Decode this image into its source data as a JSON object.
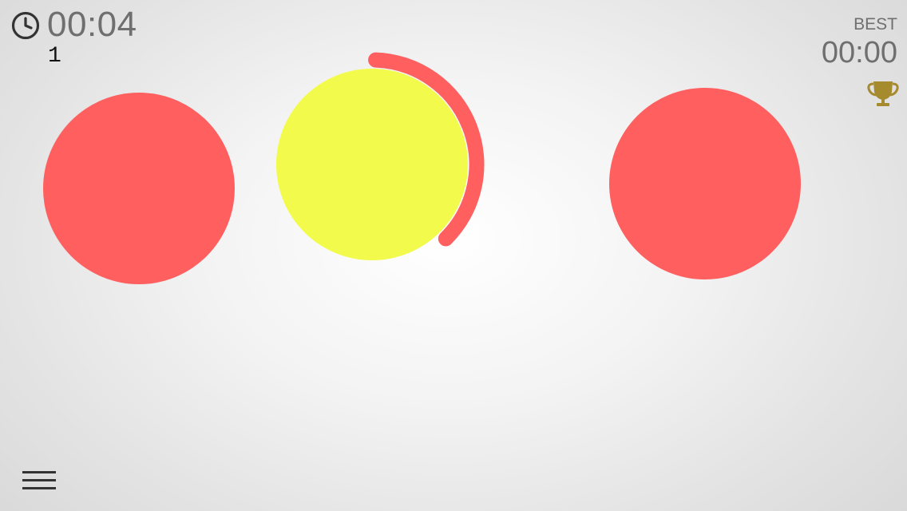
{
  "hud": {
    "timer": "00:04",
    "score": "1",
    "best_label": "BEST",
    "best_time": "00:00"
  },
  "icons": {
    "timer": "clock-icon",
    "best": "trophy-icon",
    "menu": "hamburger-menu-icon"
  },
  "circles": [
    {
      "name": "left",
      "color": "#ff5f5f"
    },
    {
      "name": "center",
      "color": "#f2fb4b",
      "active": true,
      "progress": 0.37
    },
    {
      "name": "right",
      "color": "#ff5f5f"
    }
  ],
  "colors": {
    "text": "#6f6f6f",
    "score_text": "#111111",
    "target": "#ff5f5f",
    "active": "#f2fb4b",
    "progress_ring": "#ff5f5f",
    "trophy": "#a58a2e",
    "icon_dark": "#333333"
  }
}
